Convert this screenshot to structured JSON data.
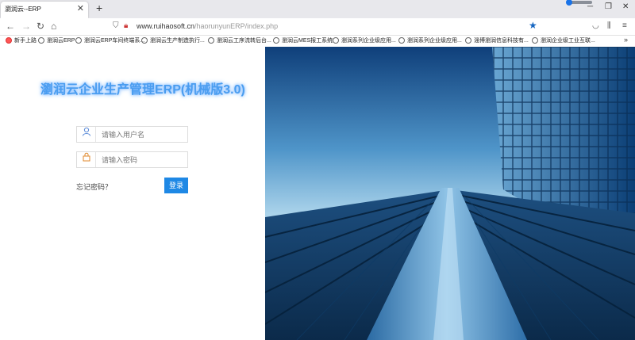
{
  "browser": {
    "tab_title": "瀏润云--ERP",
    "url_host": "www.ruihaosoft.cn",
    "url_path": "/haorunyunERP/index.php",
    "bookmarks": [
      "新手上路",
      "瀏润云ERP",
      "瀏润云ERP车间终端系...",
      "瀏润云生产制造执行...",
      "瀏润云工序流转后台...",
      "瀏润云MES报工系统",
      "瀏润系列企业级应用...",
      "瀏润系列企业级应用...",
      "淄博瀏润信息科技有...",
      "瀏润企业级工业互联..."
    ]
  },
  "login": {
    "title": "瀏润云企业生产管理ERP(机械版3.0)",
    "username_placeholder": "请输入用户名",
    "password_placeholder": "请输入密码",
    "forgot_label": "忘记密码？",
    "submit_label": "登录"
  }
}
